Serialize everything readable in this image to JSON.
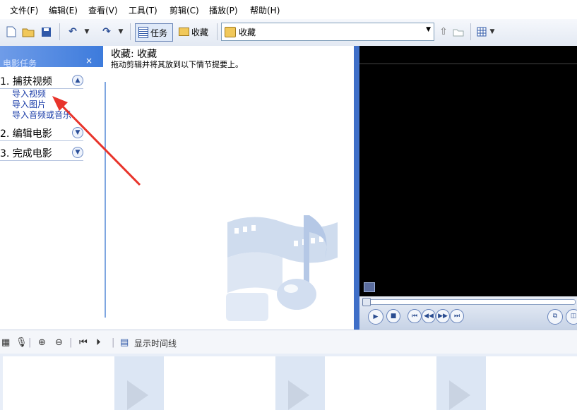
{
  "menu": [
    "文件(F)",
    "编辑(E)",
    "查看(V)",
    "工具(T)",
    "剪辑(C)",
    "播放(P)",
    "帮助(H)"
  ],
  "toolbar": {
    "tasks_label": "任务",
    "collections_label": "收藏",
    "collection_select_value": "收藏"
  },
  "tasks_pane": {
    "title": "电影任务",
    "close": "×",
    "steps": [
      {
        "label": "1.  捕获视频",
        "expanded": true
      },
      {
        "label": "2.  编辑电影",
        "expanded": false
      },
      {
        "label": "3.  完成电影",
        "expanded": false
      }
    ],
    "capture_links": [
      "导入视频",
      "导入图片",
      "导入音频或音乐"
    ]
  },
  "collection": {
    "title": "收藏: 收藏",
    "hint": "拖动剪辑并将其放到以下情节提要上。"
  },
  "timeline_toolbar": {
    "show_timeline_label": "显示时间线"
  },
  "colors": {
    "accent_blue": "#3d7bdc",
    "link_blue": "#1a3ca8",
    "annotation_arrow": "#e8342b",
    "preview_bg": "#000000"
  }
}
